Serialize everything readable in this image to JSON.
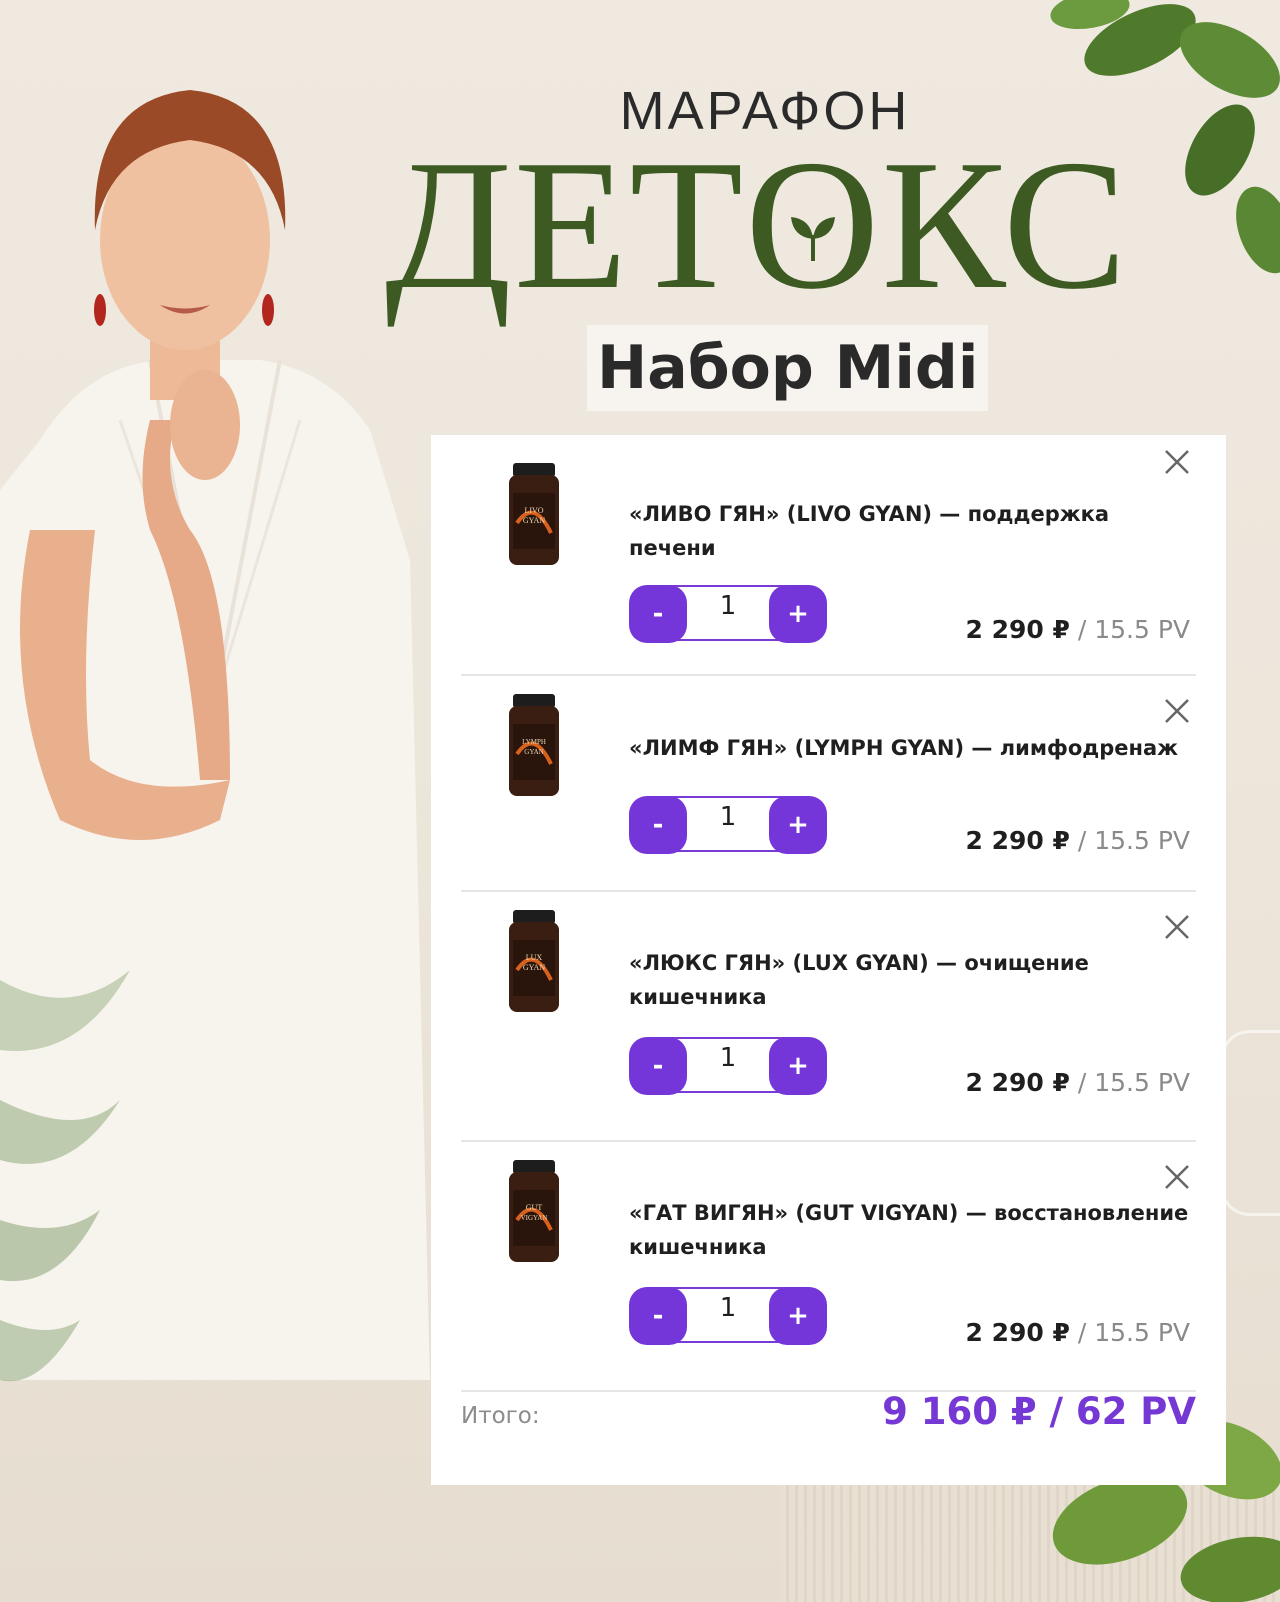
{
  "header": {
    "marathon": "МАРАФОН",
    "detox_pre": "ДЕТ",
    "detox_o": "О",
    "detox_post": "КС",
    "set_title": "Набор Midi"
  },
  "cart": {
    "items": [
      {
        "name": "«ЛИВО ГЯН» (LIVO GYAN) — поддержка печени",
        "bottle_label": "LIVO GYAN",
        "minus": "-",
        "qty": "1",
        "plus": "+",
        "price": "2 290 ₽",
        "pv": " / 15.5 PV"
      },
      {
        "name": "«ЛИМФ ГЯН» (LYMPH GYAN) — лимфодренаж",
        "bottle_label": "LYMPH GYAN",
        "minus": "-",
        "qty": "1",
        "plus": "+",
        "price": "2 290 ₽",
        "pv": " / 15.5 PV"
      },
      {
        "name": "«ЛЮКС ГЯН» (LUX GYAN) — очищение кишечника",
        "bottle_label": "LUX GYAN",
        "minus": "-",
        "qty": "1",
        "plus": "+",
        "price": "2 290 ₽",
        "pv": " / 15.5 PV"
      },
      {
        "name": "«ГАТ ВИГЯН» (GUT VIGYAN) — восстановление кишечника",
        "bottle_label": "GUT VIGYAN",
        "minus": "-",
        "qty": "1",
        "plus": "+",
        "price": "2 290 ₽",
        "pv": " / 15.5 PV"
      }
    ],
    "total_label": "Итого:",
    "total_value": "9 160 ₽ / 62 PV"
  },
  "colors": {
    "accent": "#7436d9",
    "title_green": "#3d5a23",
    "bottle": "#3a1e12"
  }
}
